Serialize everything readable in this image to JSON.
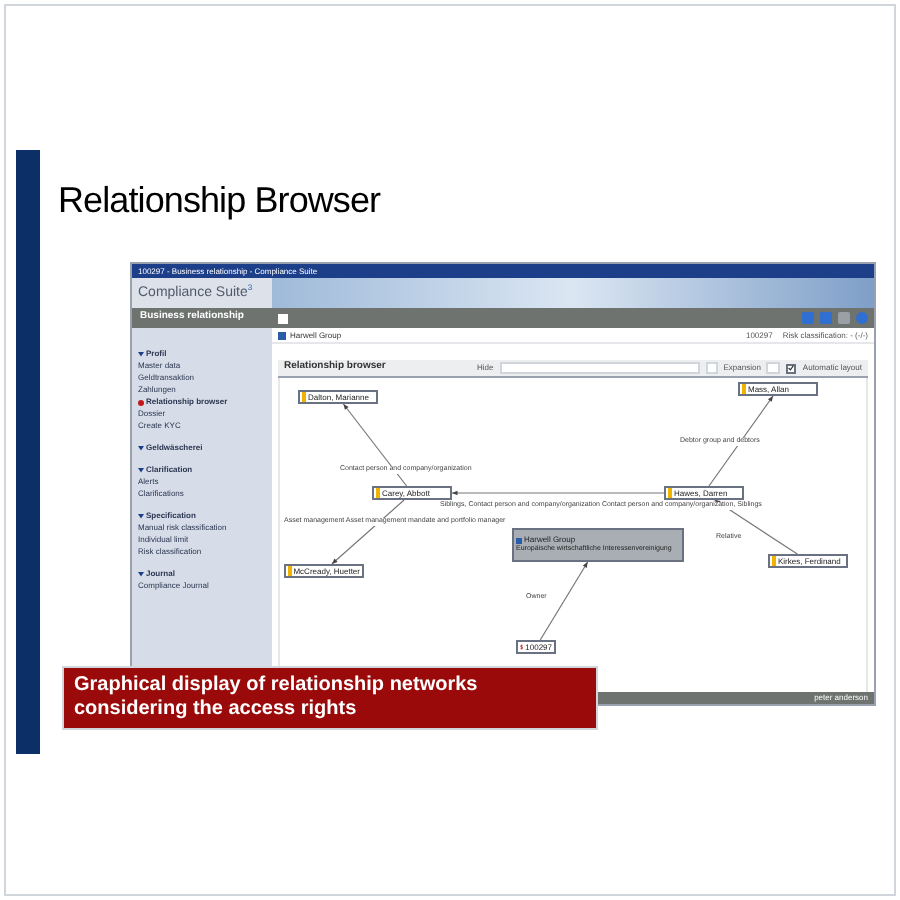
{
  "slide": {
    "title": "Relationship Browser",
    "caption": "Graphical display of relationship networks considering the access rights"
  },
  "window": {
    "title": "100297 - Business relationship - Compliance Suite",
    "app_name": "Compliance Suite",
    "app_mark": "3"
  },
  "sidebar": {
    "header": "Business relationship",
    "items": [
      {
        "kind": "section",
        "label": "Profil",
        "selected": false
      },
      {
        "kind": "item",
        "label": "Master data",
        "selected": false
      },
      {
        "kind": "item",
        "label": "Geldtransaktion",
        "selected": false
      },
      {
        "kind": "item",
        "label": "Zahlungen",
        "selected": false
      },
      {
        "kind": "item",
        "label": "Relationship browser",
        "selected": true
      },
      {
        "kind": "item",
        "label": "Dossier",
        "selected": false
      },
      {
        "kind": "item",
        "label": "Create KYC",
        "selected": false
      },
      {
        "kind": "gap"
      },
      {
        "kind": "section",
        "label": "Geldwäscherei",
        "selected": false
      },
      {
        "kind": "gap"
      },
      {
        "kind": "section",
        "label": "Clarification",
        "selected": false
      },
      {
        "kind": "item",
        "label": "Alerts",
        "selected": false
      },
      {
        "kind": "item",
        "label": "Clarifications",
        "selected": false
      },
      {
        "kind": "gap"
      },
      {
        "kind": "section",
        "label": "Specification",
        "selected": false
      },
      {
        "kind": "item",
        "label": "Manual risk classification",
        "selected": false
      },
      {
        "kind": "item",
        "label": "Individual limit",
        "selected": false
      },
      {
        "kind": "item",
        "label": "Risk classification",
        "selected": false
      },
      {
        "kind": "gap"
      },
      {
        "kind": "section",
        "label": "Journal",
        "selected": false
      },
      {
        "kind": "item",
        "label": "Compliance Journal",
        "selected": false
      }
    ]
  },
  "breadcrumb": "Harwell Group",
  "case_info": {
    "id": "100297",
    "risk": "Risk classification: - (-/-)"
  },
  "panel": {
    "title": "Relationship browser",
    "hide_label": "Hide",
    "expansion_label": "Expansion",
    "automatic_layout": {
      "label": "Automatic layout",
      "checked": true
    }
  },
  "graph": {
    "nodes": [
      {
        "kind": "person",
        "label": "Dalton, Marianne"
      },
      {
        "kind": "person",
        "label": "Carey, Abbott"
      },
      {
        "kind": "person",
        "label": "McCready, Huetter"
      },
      {
        "kind": "company",
        "label": "Harwell Group",
        "subtitle": "Europäische wirtschaftliche Interessenvereinigung"
      },
      {
        "kind": "person",
        "label": "Hawes, Darren"
      },
      {
        "kind": "person",
        "label": "Mass, Allan"
      },
      {
        "kind": "person",
        "label": "Kirkes, Ferdinand"
      },
      {
        "kind": "case",
        "label": "100297"
      }
    ],
    "edges": [
      {
        "label": "Debtor group and debtors"
      },
      {
        "label": "Contact person and company/organization"
      },
      {
        "label": "Siblings, Contact person and company/organization Contact person and company/organization, Siblings"
      },
      {
        "label": "Asset management Asset management mandate and portfolio manager"
      },
      {
        "label": "Relative"
      },
      {
        "label": "Owner"
      }
    ]
  },
  "status_bar": {
    "user": "peter anderson"
  }
}
